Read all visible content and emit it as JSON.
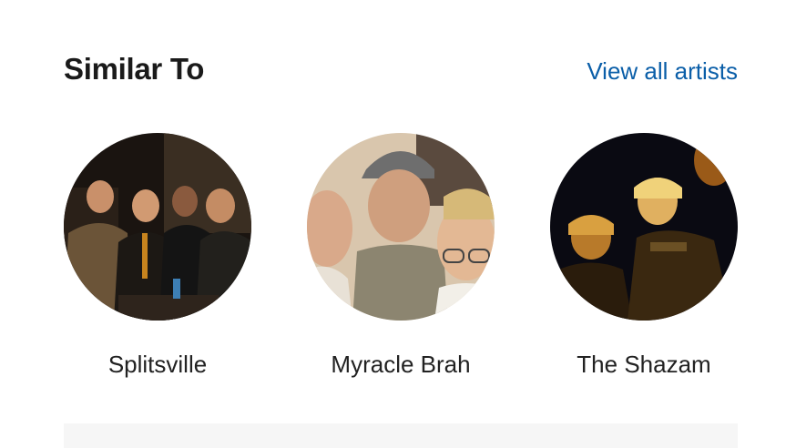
{
  "section": {
    "title": "Similar To",
    "view_all_label": "View all artists",
    "link_color": "#0a5ea8"
  },
  "artists": [
    {
      "name": "Splitsville",
      "photo": "splitsville-band-photo"
    },
    {
      "name": "Myracle Brah",
      "photo": "myracle-brah-band-photo"
    },
    {
      "name": "The Shazam",
      "photo": "the-shazam-band-photo"
    }
  ]
}
